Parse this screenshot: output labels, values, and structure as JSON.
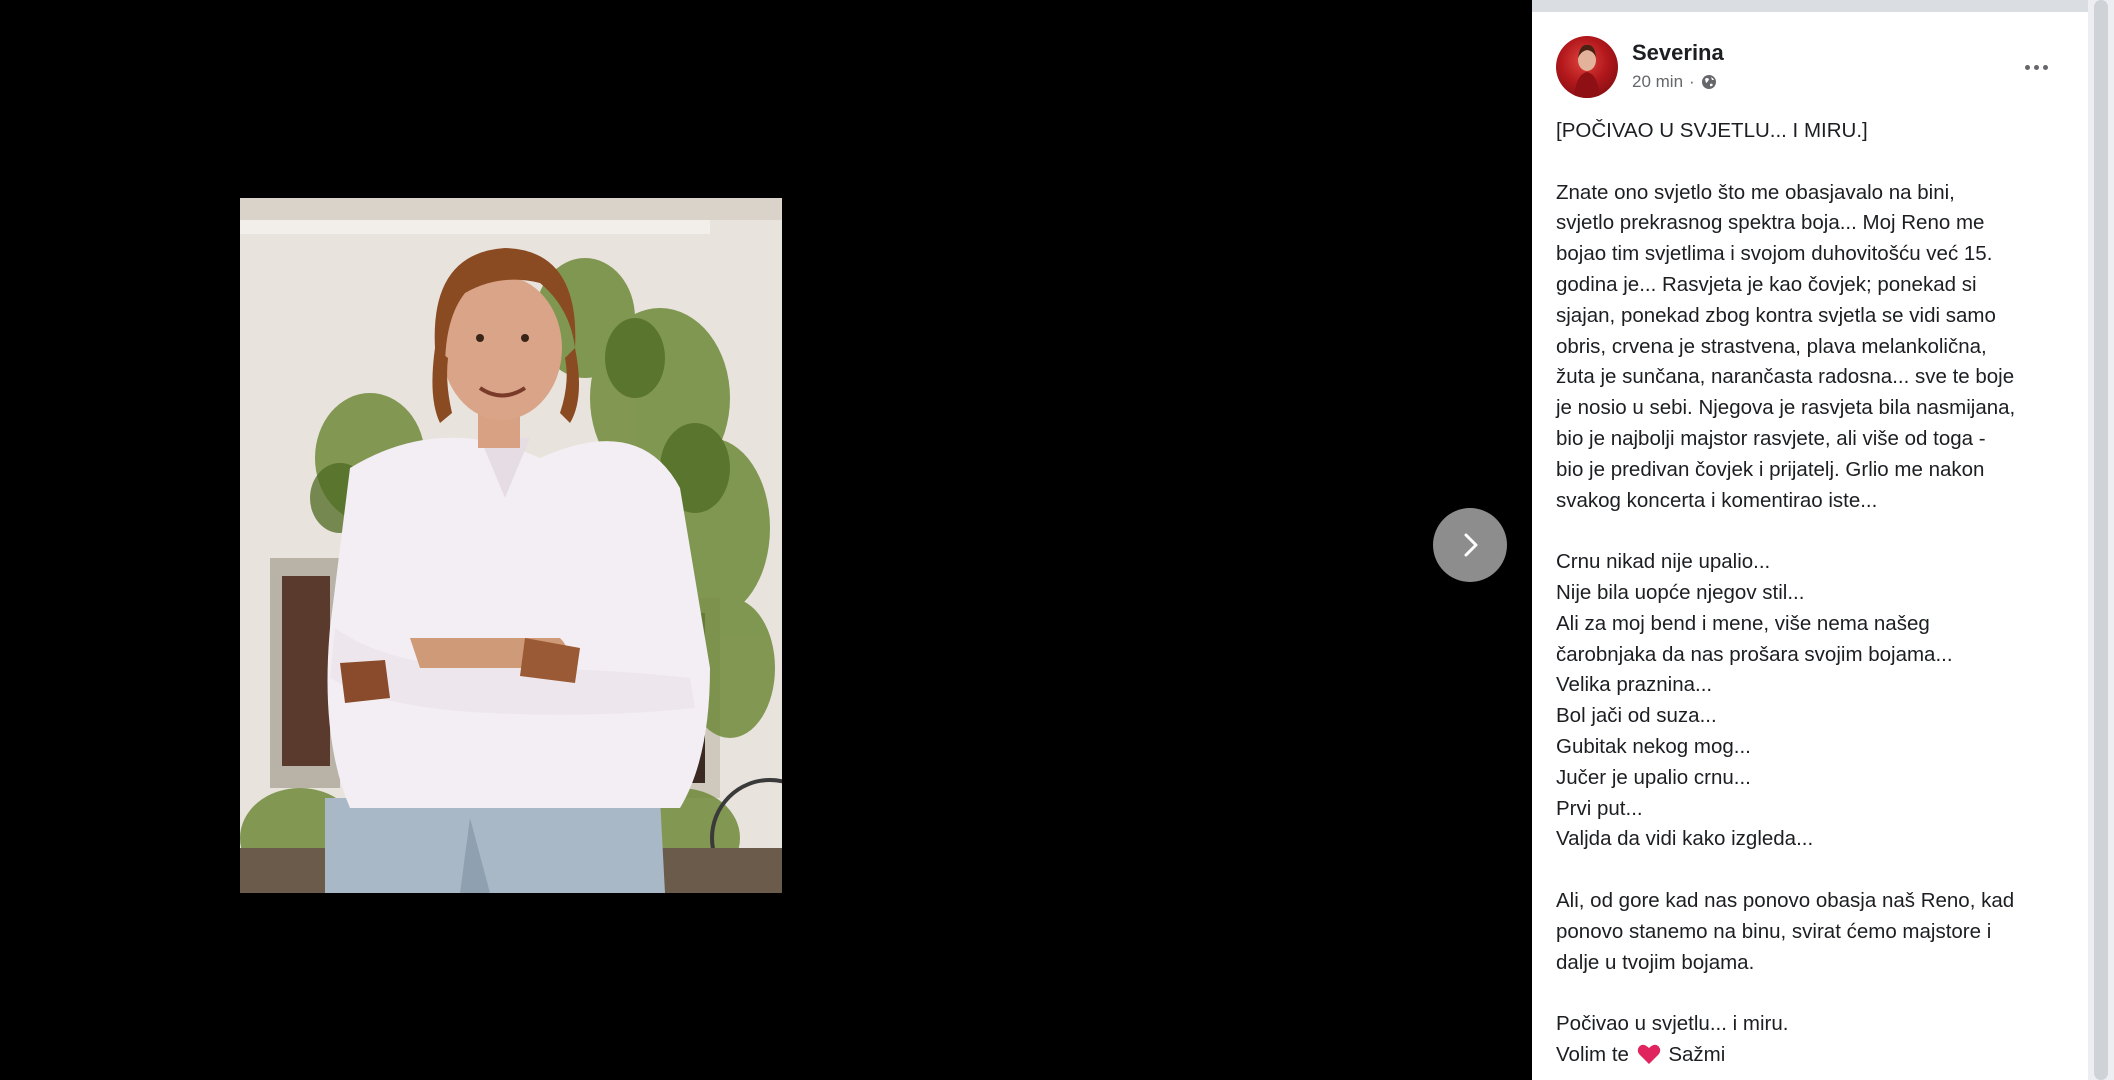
{
  "post": {
    "author": "Severina",
    "time": "20 min",
    "privacy_icon": "globe-icon",
    "more_icon": "more-options-icon",
    "lines": [
      "[POČIVAO U SVJETLU... I MIRU.]",
      "",
      "Znate ono svjetlo što me obasjavalo na bini,",
      "svjetlo prekrasnog spektra boja... Moj Reno me",
      "bojao tim svjetlima i svojom duhovitošću već 15.",
      "godina je... Rasvjeta je kao čovjek; ponekad si",
      "sjajan, ponekad zbog kontra svjetla se vidi samo",
      "obris, crvena je strastvena, plava melankolična,",
      "žuta je sunčana, narančasta radosna... sve te boje",
      "je nosio u sebi. Njegova je rasvjeta bila nasmijana,",
      "bio je najbolji majstor rasvjete, ali više od toga -",
      "bio je predivan čovjek i prijatelj. Grlio me nakon",
      "svakog koncerta i komentirao iste...",
      "",
      "Crnu nikad nije upalio...",
      "Nije bila uopće njegov stil...",
      "Ali za moj bend i mene, više nema našeg",
      "čarobnjaka da nas prošara svojim bojama...",
      "Velika praznina...",
      "Bol jači od suza...",
      "Gubitak nekog mog...",
      "Jučer je upalio crnu...",
      "Prvi put...",
      "Valjda da vidi kako izgleda...",
      "",
      "Ali, od gore kad nas ponovo obasja naš Reno, kad",
      "ponovo stanemo na binu, svirat ćemo majstore i",
      "dalje u tvojim bojama.",
      "",
      "Počivao u svjetlu... i miru."
    ],
    "closing_prefix": "Volim te",
    "closing_suffix": "Sažmi",
    "heart_color": "#e0245e"
  },
  "viewer": {
    "next_icon": "chevron-right-icon"
  }
}
